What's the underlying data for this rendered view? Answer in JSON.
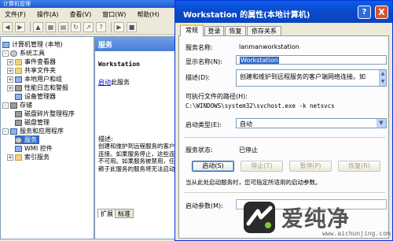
{
  "back_window": {
    "title": "计算机管理",
    "menu": [
      "文件(F)",
      "操作(A)",
      "查看(V)",
      "窗口(W)",
      "帮助(H)"
    ],
    "tree": [
      {
        "label": "计算机管理 (本地)",
        "level": 0,
        "icon": "computer-icon"
      },
      {
        "label": "系统工具",
        "level": 1,
        "expander": "-",
        "icon": "tools-icon"
      },
      {
        "label": "事件查看器",
        "level": 2,
        "expander": "+",
        "icon": "event-viewer-icon"
      },
      {
        "label": "共享文件夹",
        "level": 2,
        "expander": "+",
        "icon": "shared-folder-icon"
      },
      {
        "label": "本地用户和组",
        "level": 2,
        "expander": "+",
        "icon": "users-icon"
      },
      {
        "label": "性能日志和警报",
        "level": 2,
        "expander": "+",
        "icon": "performance-icon"
      },
      {
        "label": "设备管理器",
        "level": 2,
        "expander": "",
        "icon": "device-manager-icon"
      },
      {
        "label": "存储",
        "level": 1,
        "expander": "-",
        "icon": "storage-icon"
      },
      {
        "label": "磁盘碎片整理程序",
        "level": 2,
        "expander": "",
        "icon": "defrag-icon"
      },
      {
        "label": "磁盘管理",
        "level": 2,
        "expander": "",
        "icon": "disk-icon"
      },
      {
        "label": "服务和应用程序",
        "level": 1,
        "expander": "-",
        "icon": "services-apps-icon"
      },
      {
        "label": "服务",
        "level": 2,
        "expander": "",
        "icon": "gear-icon",
        "selected": true
      },
      {
        "label": "WMI 控件",
        "level": 2,
        "expander": "",
        "icon": "wmi-icon"
      },
      {
        "label": "索引服务",
        "level": 2,
        "expander": "+",
        "icon": "index-icon"
      }
    ],
    "services_pane": {
      "header": "服务",
      "service_name": "Workstation",
      "start_link": "启动",
      "start_suffix": "此服务",
      "desc_label": "描述:",
      "desc_text": "创建和维护到远程服务的客户\n连接。如果服务停止，这些连\n不可用。如果服务被禁用，任何\n赖于此服务的服务将无法启动"
    },
    "tabs": [
      "扩展",
      "标准"
    ]
  },
  "dialog": {
    "title": "Workstation 的属性(本地计算机)",
    "help_label": "?",
    "close_label": "X",
    "tabs": [
      "常规",
      "登录",
      "恢复",
      "依存关系"
    ],
    "service_name_label": "服务名称:",
    "service_name_value": "lanmanworkstation",
    "display_name_label": "显示名称(N):",
    "display_name_value": "Workstation",
    "description_label": "描述(D):",
    "description_value": "创建和维护到远程服务的客户端网络连接。如",
    "path_label": "可执行文件的路径(H):",
    "path_value": "C:\\WINDOWS\\system32\\svchost.exe -k netsvcs",
    "startup_type_label": "启动类型(E):",
    "startup_type_value": "自动",
    "status_label": "服务状态:",
    "status_value": "已停止",
    "buttons": {
      "start": "启动(S)",
      "stop": "停止(T)",
      "pause": "暂停(P)",
      "resume": "恢复(R)"
    },
    "hint": "当从此处启动服务时，您可指定所适用的启动参数。",
    "params_label": "启动参数(M):"
  },
  "watermark": {
    "name": "爱纯净",
    "url": "www.aichunjing.com"
  }
}
